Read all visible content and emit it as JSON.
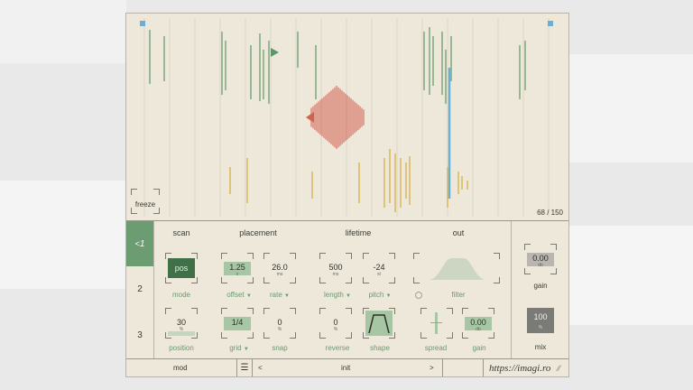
{
  "viz": {
    "freeze_label": "freeze",
    "counter": "68 / 150"
  },
  "tabs": [
    {
      "label": "1",
      "active": true,
      "icon": "share-icon"
    },
    {
      "label": "2",
      "active": false
    },
    {
      "label": "3",
      "active": false
    }
  ],
  "sections": {
    "scan": "scan",
    "placement": "placement",
    "lifetime": "lifetime",
    "out": "out"
  },
  "params": {
    "mode": {
      "value": "pos",
      "label": "mode"
    },
    "offset": {
      "value": "1.25",
      "unit": "x",
      "label": "offset"
    },
    "rate": {
      "value": "26.0",
      "unit": "ms",
      "label": "rate"
    },
    "length": {
      "value": "500",
      "unit": "ms",
      "label": "length"
    },
    "pitch": {
      "value": "-24",
      "unit": "st",
      "label": "pitch"
    },
    "filter": {
      "label": "filter"
    },
    "position": {
      "value": "30",
      "unit": "%",
      "label": "position"
    },
    "grid": {
      "value": "1/4",
      "label": "grid"
    },
    "snap": {
      "value": "0",
      "unit": "%",
      "label": "snap"
    },
    "reverse": {
      "value": "0",
      "unit": "%",
      "label": "reverse"
    },
    "shape": {
      "label": "shape"
    },
    "spread": {
      "label": "spread"
    },
    "gain_out": {
      "value": "0.00",
      "unit": "db",
      "label": "gain"
    },
    "gain_master": {
      "value": "0.00",
      "unit": "db",
      "label": "gain"
    },
    "mix": {
      "value": "100",
      "unit": "%",
      "label": "mix"
    }
  },
  "bottombar": {
    "mod": "mod",
    "prev": "<",
    "preset": "init",
    "next": ">",
    "url": "https://imagi.ro"
  },
  "colors": {
    "panel": "#ede8da",
    "accent_green": "#6c9d72",
    "grain_red": "#d97a6a",
    "grain_yellow": "#d8b85a",
    "playhead_blue": "#6ab0d6"
  }
}
